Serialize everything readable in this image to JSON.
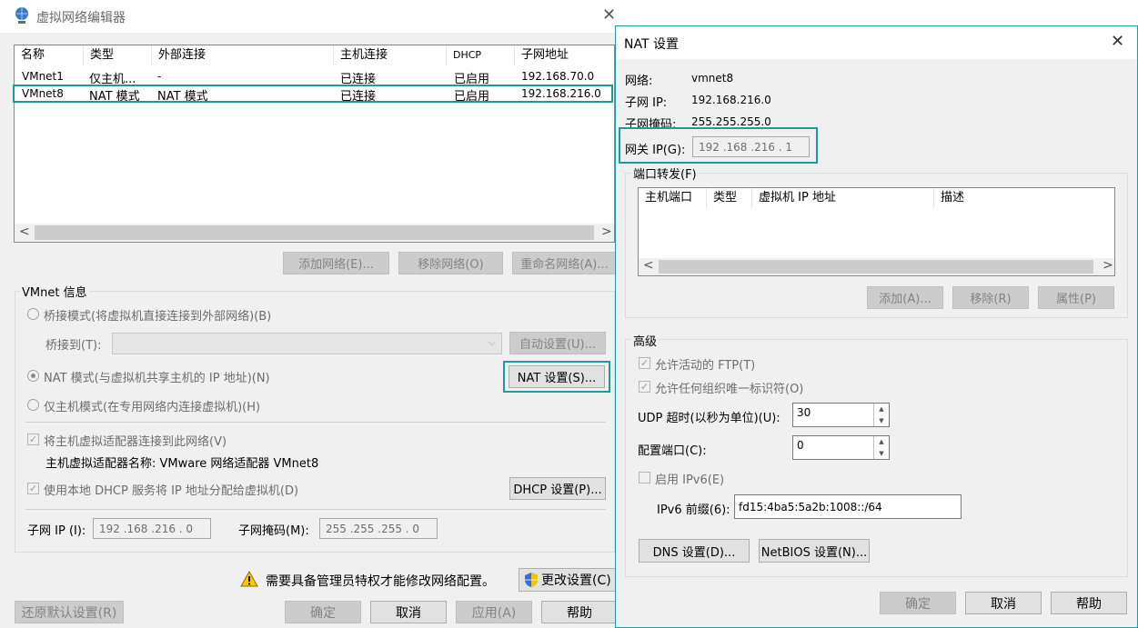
{
  "main_window": {
    "title": "虚拟网络编辑器",
    "table": {
      "headers": [
        "名称",
        "类型",
        "外部连接",
        "主机连接",
        "DHCP",
        "子网地址"
      ],
      "rows": [
        [
          "VMnet1",
          "仅主机...",
          "-",
          "已连接",
          "已启用",
          "192.168.70.0"
        ],
        [
          "VMnet8",
          "NAT 模式",
          "NAT 模式",
          "已连接",
          "已启用",
          "192.168.216.0"
        ]
      ]
    },
    "buttons": {
      "add_network": "添加网络(E)...",
      "remove_network": "移除网络(O)",
      "rename_network": "重命名网络(A)..."
    },
    "vmnet_info": {
      "group_label": "VMnet 信息",
      "bridge_mode": "桥接模式(将虚拟机直接连接到外部网络)(B)",
      "bridge_to_label": "桥接到(T):",
      "auto_settings": "自动设置(U)...",
      "nat_mode": "NAT 模式(与虚拟机共享主机的 IP 地址)(N)",
      "nat_settings": "NAT 设置(S)...",
      "host_only_mode": "仅主机模式(在专用网络内连接虚拟机)(H)",
      "connect_adapter": "将主机虚拟适配器连接到此网络(V)",
      "adapter_name": "主机虚拟适配器名称: VMware 网络适配器 VMnet8",
      "use_dhcp": "使用本地 DHCP 服务将 IP 地址分配给虚拟机(D)",
      "dhcp_settings": "DHCP 设置(P)...",
      "subnet_ip_label": "子网 IP (I):",
      "subnet_ip": "192 .168 .216 .  0",
      "subnet_mask_label": "子网掩码(M):",
      "subnet_mask": "255 .255 .255 .  0"
    },
    "admin_notice": "需要具备管理员特权才能修改网络配置。",
    "change_settings": "更改设置(C)",
    "restore_defaults": "还原默认设置(R)",
    "ok": "确定",
    "cancel": "取消",
    "apply": "应用(A)",
    "help": "帮助"
  },
  "nat_dialog": {
    "title": "NAT 设置",
    "network_label": "网络:",
    "network": "vmnet8",
    "subnet_ip_label": "子网 IP:",
    "subnet_ip": "192.168.216.0",
    "subnet_mask_label": "子网掩码:",
    "subnet_mask": "255.255.255.0",
    "gateway_label": "网关 IP(G):",
    "gateway": "192 .168 .216 .  1",
    "port_forwarding_label": "端口转发(F)",
    "pf_headers": [
      "主机端口",
      "类型",
      "虚拟机 IP 地址",
      "描述"
    ],
    "pf_add": "添加(A)...",
    "pf_remove": "移除(R)",
    "pf_properties": "属性(P)",
    "advanced_label": "高级",
    "allow_ftp": "允许活动的 FTP(T)",
    "allow_oui": "允许任何组织唯一标识符(O)",
    "udp_timeout_label": "UDP 超时(以秒为单位)(U):",
    "udp_timeout": "30",
    "config_port_label": "配置端口(C):",
    "config_port": "0",
    "enable_ipv6": "启用 IPv6(E)",
    "ipv6_prefix_label": "IPv6 前缀(6):",
    "ipv6_prefix": "fd15:4ba5:5a2b:1008::/64",
    "dns_settings": "DNS 设置(D)...",
    "netbios_settings": "NetBIOS 设置(N)...",
    "ok": "确定",
    "cancel": "取消",
    "help": "帮助"
  },
  "colors": {
    "highlight": "#1c9a9e",
    "window_bg": "#f0f0f0",
    "dialog_border": "#1c9a9e"
  }
}
